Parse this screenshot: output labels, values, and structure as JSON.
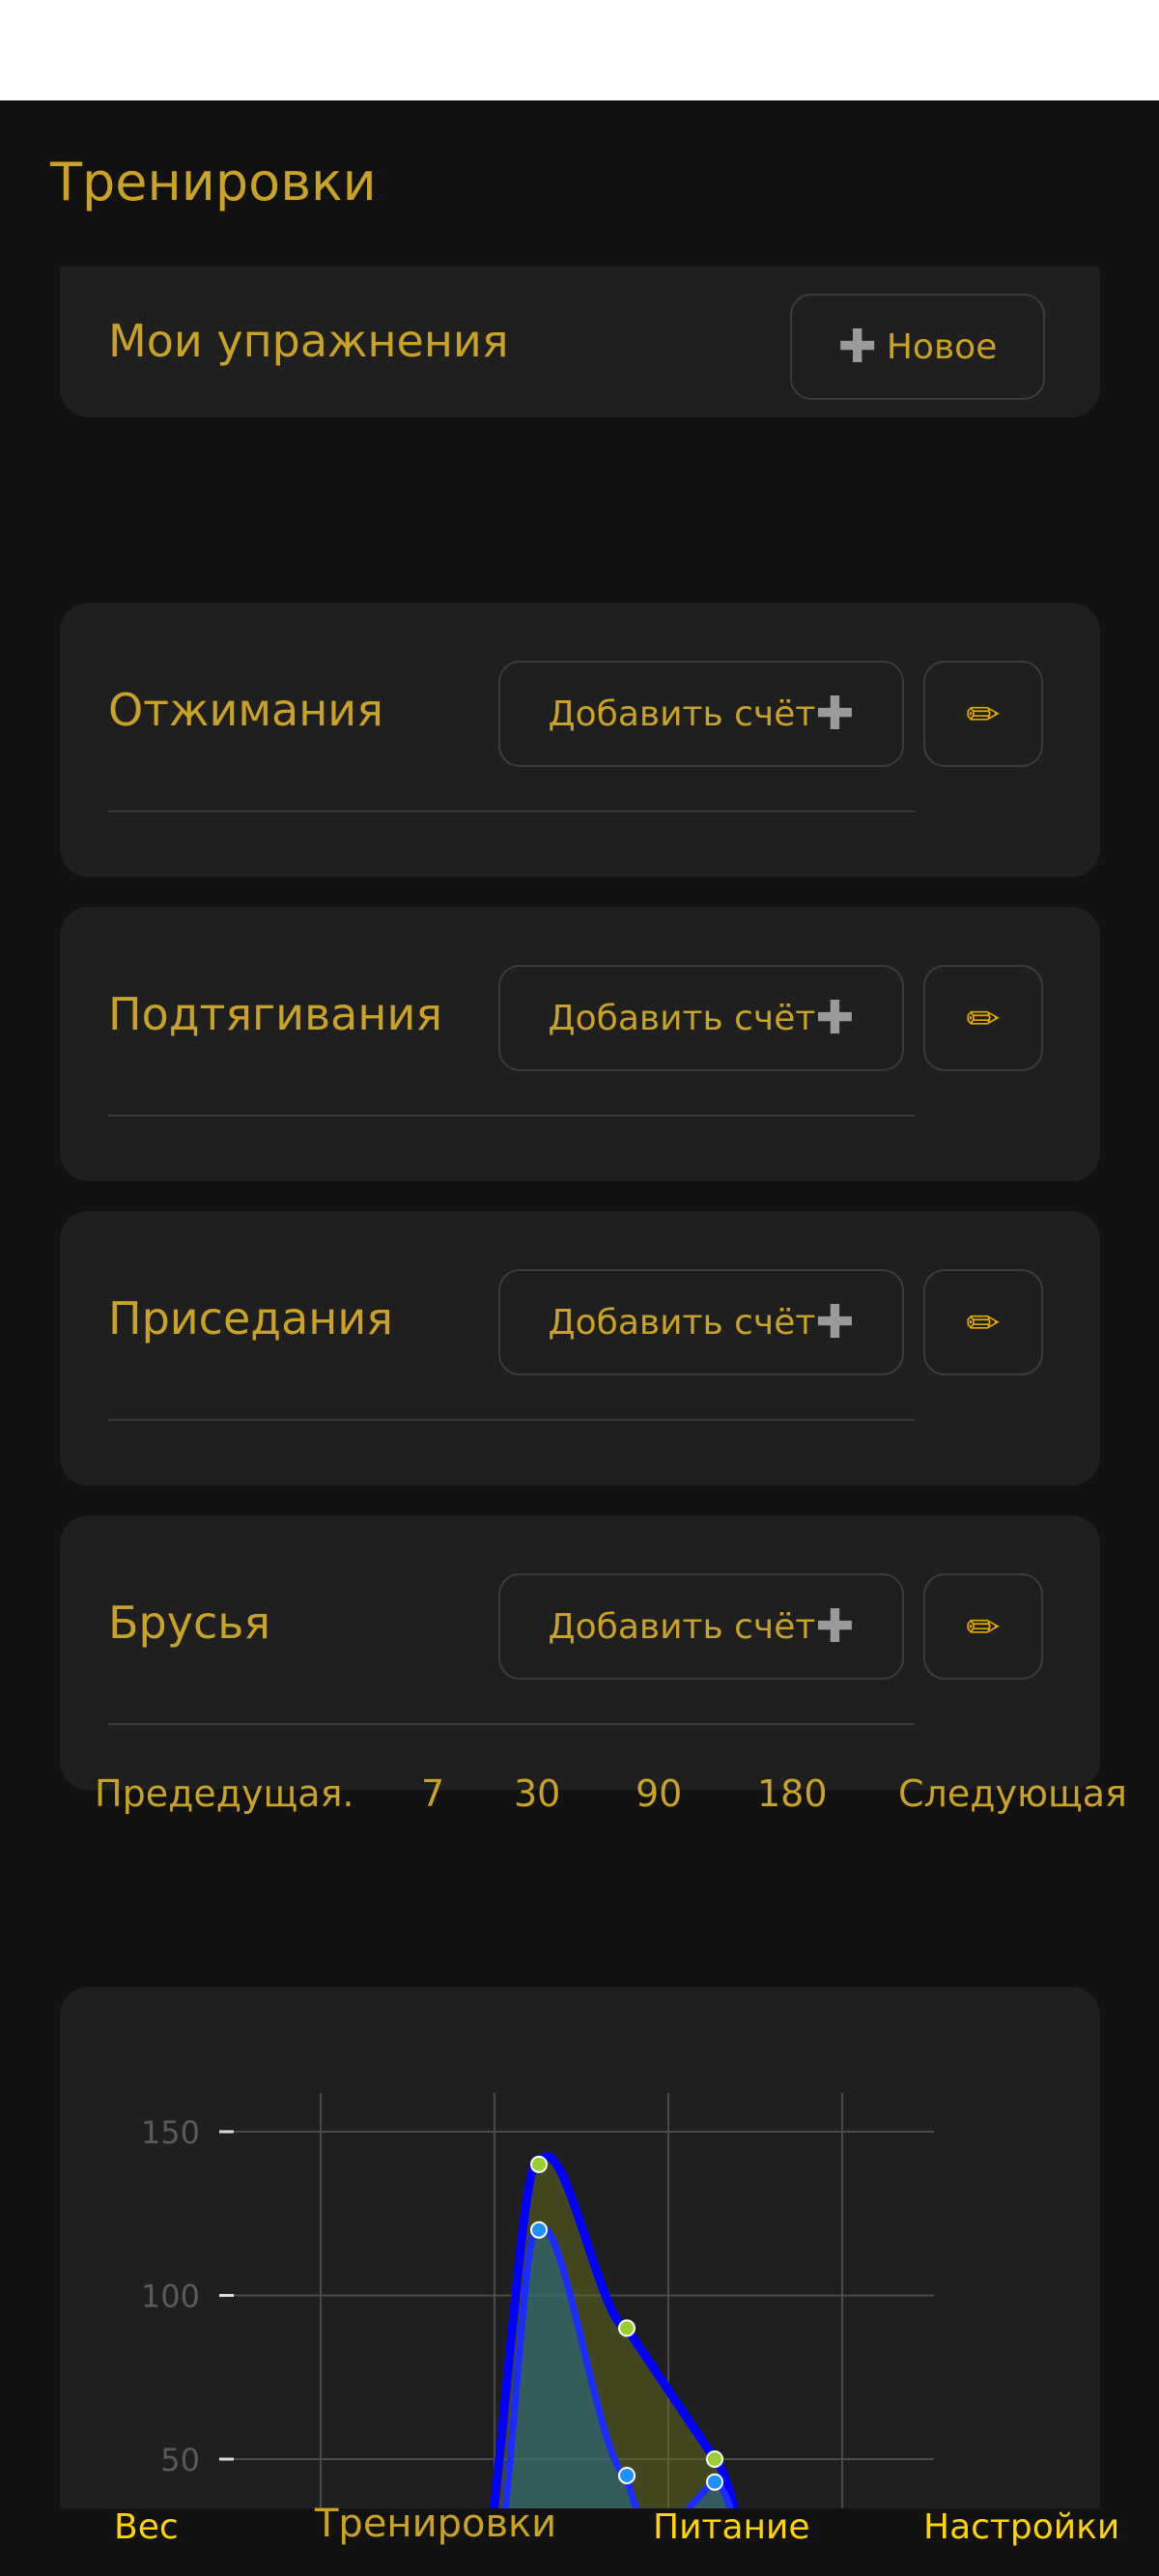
{
  "header": {
    "title": "Тренировки"
  },
  "my_exercises": {
    "title": "Мои упражнения",
    "new_button": "Новое"
  },
  "exercises": [
    {
      "name": "Отжимания",
      "add_label": "Добавить счёт"
    },
    {
      "name": "Подтягивания",
      "add_label": "Добавить счёт"
    },
    {
      "name": "Приседания",
      "add_label": "Добавить счёт"
    },
    {
      "name": "Брусья",
      "add_label": "Добавить счёт"
    }
  ],
  "period": {
    "prev": "Предедущая.",
    "options": [
      "7",
      "30",
      "90",
      "180"
    ],
    "next": "Следующая"
  },
  "chart_data": {
    "type": "area",
    "yticks": [
      "150",
      "100",
      "50"
    ],
    "ylim": [
      0,
      150
    ],
    "grid": true,
    "series": [
      {
        "color": "#9acd32",
        "points": [
          [
            0.0,
            140
          ],
          [
            1.0,
            90
          ],
          [
            2.0,
            50
          ]
        ]
      },
      {
        "color": "#1e90ff",
        "points": [
          [
            0.0,
            120
          ],
          [
            1.0,
            45
          ],
          [
            2.0,
            43
          ]
        ]
      }
    ]
  },
  "nav": {
    "items": [
      {
        "label": "Вес",
        "active": false
      },
      {
        "label": "Тренировки",
        "active": true
      },
      {
        "label": "Питание",
        "active": false
      },
      {
        "label": "Настройки",
        "active": false
      }
    ]
  },
  "colors": {
    "accent": "#c9a227",
    "background": "#121212",
    "card": "#1f1f1f"
  }
}
